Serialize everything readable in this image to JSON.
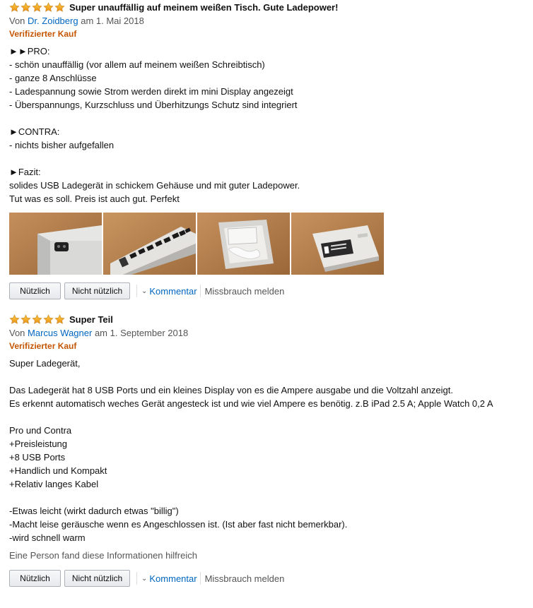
{
  "reviews": [
    {
      "rating": 5,
      "title": "Super unauffällig auf meinem weißen Tisch. Gute Ladepower!",
      "by_prefix": "Von",
      "author": "Dr. Zoidberg",
      "date": "am 1. Mai 2018",
      "verified": "Verifizierter Kauf",
      "body_lines": [
        "►►PRO:",
        "- schön unauffällig (vor allem auf meinem weißen Schreibtisch)",
        "- ganze 8 Anschlüsse",
        "- Ladespannung sowie Strom werden direkt im mini Display angezeigt",
        "- Überspannungs, Kurzschluss und Überhitzungs Schutz sind integriert",
        "",
        "►CONTRA:",
        "- nichts bisher aufgefallen",
        "",
        "►Fazit:",
        "solides USB Ladegerät in schickem Gehäuse und mit guter Ladepower.",
        "Tut was es soll. Preis ist auch gut. Perfekt"
      ],
      "actions": {
        "helpful": "Nützlich",
        "not_helpful": "Nicht nützlich",
        "comment": "Kommentar",
        "report": "Missbrauch melden"
      }
    },
    {
      "rating": 5,
      "title": "Super Teil",
      "by_prefix": "Von",
      "author": "Marcus Wagner",
      "date": "am 1. September 2018",
      "verified": "Verifizierter Kauf",
      "body_lines": [
        "Super Ladegerät,",
        "",
        "Das Ladegerät hat 8 USB Ports und ein kleines Display von es die Ampere ausgabe und die Voltzahl anzeigt.",
        "Es erkennt automatisch weches Gerät angesteck ist und wie viel Ampere es benötig. z.B iPad 2.5 A; Apple Watch 0,2 A",
        "",
        "Pro und Contra",
        "+Preisleistung",
        "+8 USB Ports",
        "+Handlich und Kompakt",
        "+Relativ langes Kabel",
        "",
        "-Etwas leicht (wirkt dadurch etwas \"billig\")",
        "-Macht leise geräusche wenn es Angeschlossen ist. (Ist aber fast nicht bemerkbar).",
        "-wird schnell warm"
      ],
      "helpful_note": "Eine Person fand diese Informationen hilfreich",
      "actions": {
        "helpful": "Nützlich",
        "not_helpful": "Nicht nützlich",
        "comment": "Kommentar",
        "report": "Missbrauch melden"
      }
    }
  ],
  "colors": {
    "star": "#f0a11f",
    "link": "#0066c0",
    "verified": "#c45500"
  }
}
